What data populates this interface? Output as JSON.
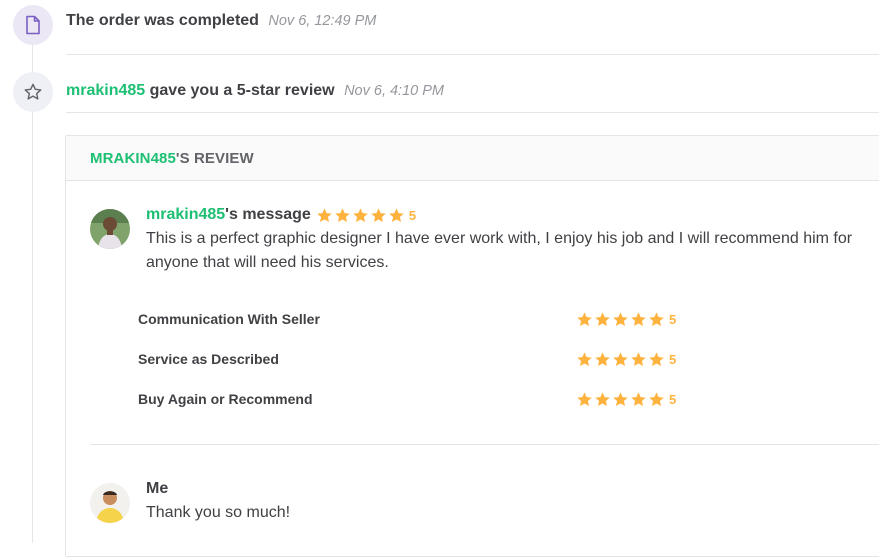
{
  "events": [
    {
      "icon": "document-icon",
      "text": "The order was completed",
      "time": "Nov 6, 12:49 PM"
    },
    {
      "icon": "star-outline-icon",
      "user": "mrakin485",
      "text": " gave you a 5-star review",
      "time": "Nov 6, 4:10 PM"
    }
  ],
  "review": {
    "header_user": "MRAKIN485",
    "header_suffix": "'S REVIEW",
    "buyer": {
      "name": "mrakin485",
      "label_suffix": "'s message",
      "rating": "5",
      "message": "This is a perfect graphic designer I have ever work with, I enjoy his job and I will recommend him for anyone that will need his services."
    },
    "criteria": [
      {
        "label": "Communication With Seller",
        "rating": "5"
      },
      {
        "label": "Service as Described",
        "rating": "5"
      },
      {
        "label": "Buy Again or Recommend",
        "rating": "5"
      }
    ],
    "reply": {
      "name": "Me",
      "message": "Thank you so much!"
    }
  },
  "colors": {
    "accent_green": "#1dbf73",
    "star_orange": "#ffb33e",
    "text_dark": "#404145",
    "text_muted": "#95979d"
  }
}
